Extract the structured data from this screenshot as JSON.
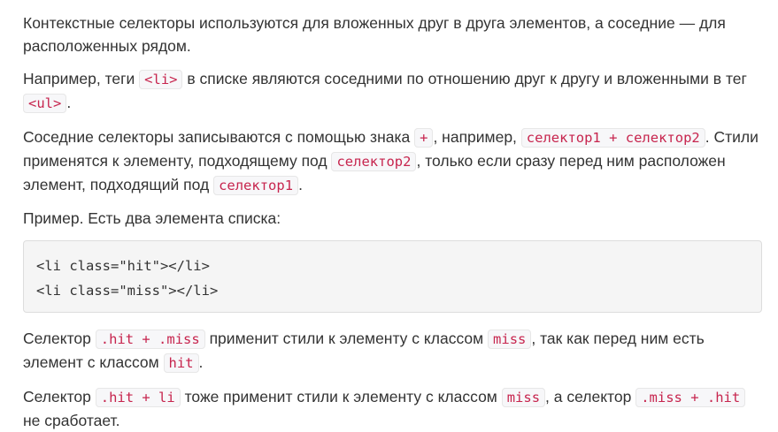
{
  "paragraphs": {
    "p1": {
      "text": "Контекстные селекторы используются для вложенных друг в друга элементов, а соседние — для расположенных рядом."
    },
    "p2": {
      "t1": "Например, теги ",
      "c1": "<li>",
      "t2": " в списке являются соседними по отношению друг к другу и вложенными в тег ",
      "c2": "<ul>",
      "t3": "."
    },
    "p3": {
      "t1": "Соседние селекторы записываются с помощью знака ",
      "c1": "+",
      "t2": ", например, ",
      "c2": "селектор1 + селектор2",
      "t3": ". Стили применятся к элементу, подходящему под ",
      "c3": "селектор2",
      "t4": ", только если сразу перед ним расположен элемент, подходящий под ",
      "c4": "селектор1",
      "t5": "."
    },
    "p4": {
      "text": "Пример. Есть два элемента списка:"
    },
    "p5": {
      "t1": "Селектор ",
      "c1": ".hit + .miss",
      "t2": " применит стили к элементу с классом ",
      "c2": "miss",
      "t3": ", так как перед ним есть элемент с классом ",
      "c3": "hit",
      "t4": "."
    },
    "p6": {
      "t1": "Селектор ",
      "c1": ".hit + li",
      "t2": " тоже применит стили к элементу с классом ",
      "c2": "miss",
      "t3": ", а селектор ",
      "c3": ".miss + .hit",
      "t4": " не сработает."
    }
  },
  "code_block": {
    "lines": [
      "<li class=\"hit\"></li>",
      "<li class=\"miss\"></li>"
    ]
  }
}
